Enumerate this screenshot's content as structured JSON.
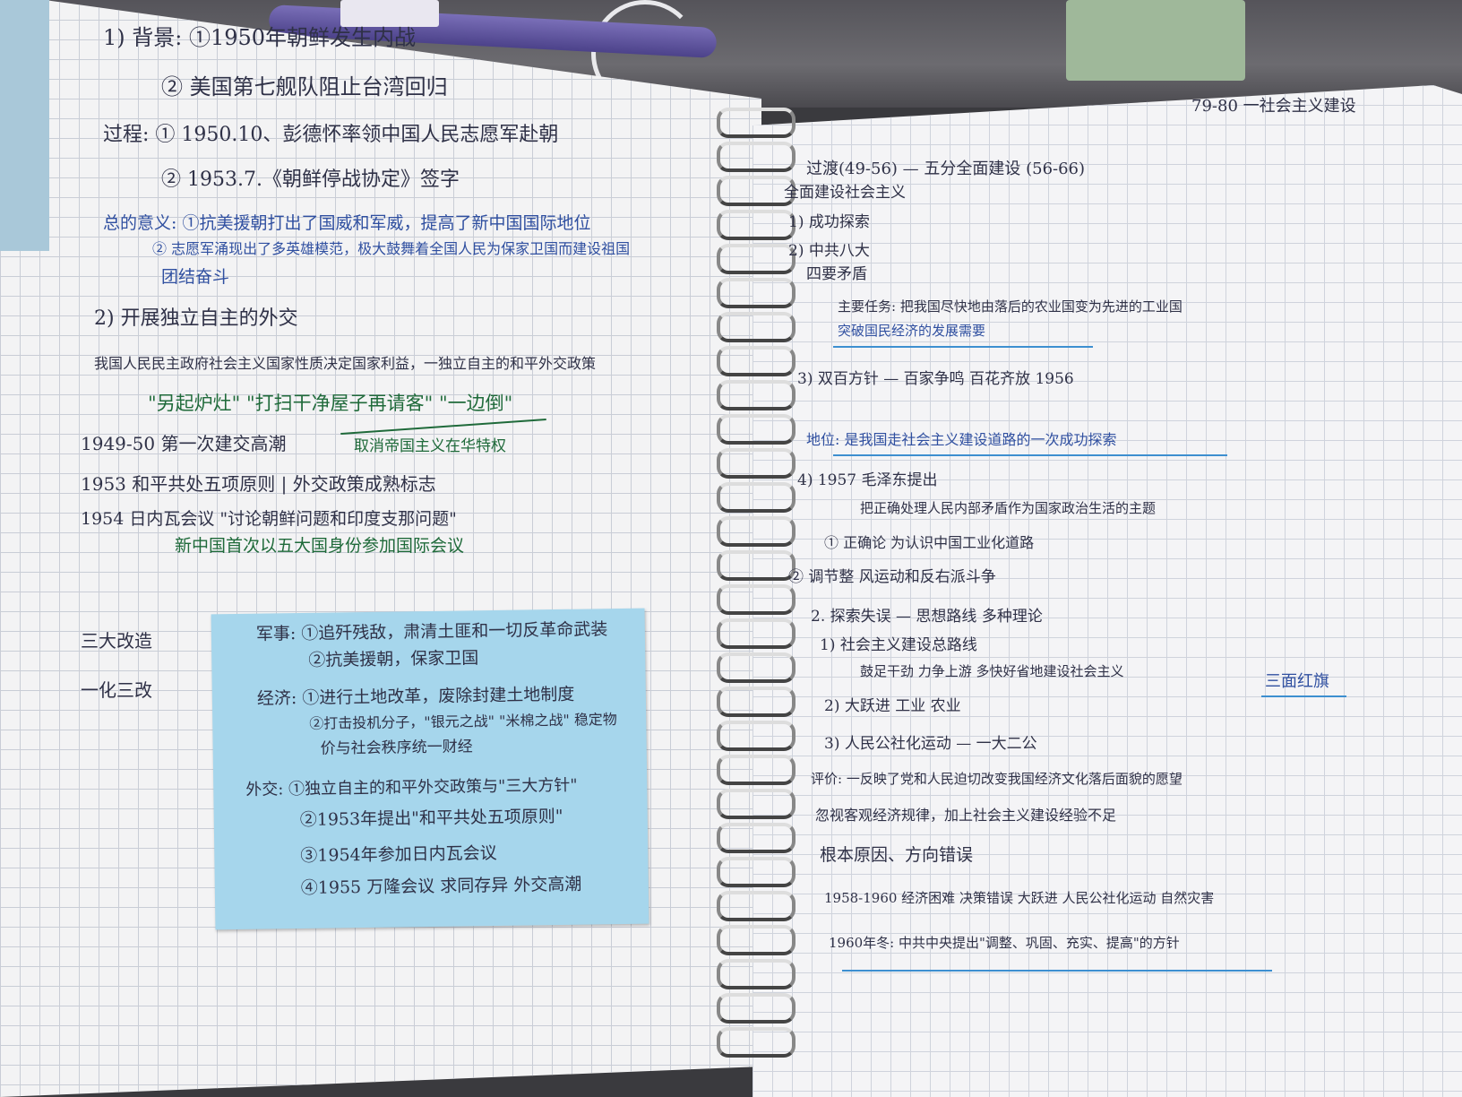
{
  "scene": {
    "description_colors": {
      "paper": "#f3f3f4",
      "grid": "#c9cdd6",
      "sticky_note": "#a6d6ec",
      "ink_dark": "#2f3147",
      "ink_blue": "#2f4fa0",
      "ink_green": "#1f6a3a"
    }
  },
  "left_page": {
    "lines": [
      "1) 背景: ①1950年朝鲜发生内战",
      "② 美国第七舰队阻止台湾回归",
      "过程: ① 1950.10、彭德怀率领中国人民志愿军赴朝",
      "② 1953.7.《朝鲜停战协定》签字",
      "总的意义: ①抗美援朝打出了国威和军威，提高了新中国国际地位",
      "② 志愿军涌现出了多英雄模范，极大鼓舞着全国人民为保家卫国而建设祖国",
      "团结奋斗",
      "2) 开展独立自主的外交",
      "我国人民民主政府社会主义国家性质决定国家利益，一独立自主的和平外交政策",
      "\"另起炉灶\"  \"打扫干净屋子再请客\"  \"一边倒\"",
      "取消帝国主义在华特权",
      "1949-50  第一次建交高潮",
      "1953  和平共处五项原则 | 外交政策成熟标志",
      "1954  日内瓦会议 \"讨论朝鲜问题和印度支那问题\"",
      "新中国首次以五大国身份参加国际会议",
      "三大改造",
      "一化三改"
    ],
    "sticky_note": [
      "军事: ①追歼残敌，肃清土匪和一切反革命武装",
      "②抗美援朝，保家卫国",
      "经济: ①进行土地改革，废除封建土地制度",
      "②打击投机分子，\"银元之战\" \"米棉之战\" 稳定物",
      "价与社会秩序统一财经",
      "外交: ①独立自主的和平外交政策与\"三大方针\"",
      "②1953年提出\"和平共处五项原则\"",
      "③1954年参加日内瓦会议",
      "④1955 万隆会议 求同存异 外交高潮"
    ]
  },
  "right_page": {
    "lines": [
      "79-80 一社会主义建设",
      "过渡(49-56) — 五分全面建设 (56-66)",
      "全面建设社会主义",
      "1) 成功探索",
      "2) 中共八大",
      "四要矛盾",
      "主要任务: 把我国尽快地由落后的农业国变为先进的工业国",
      "突破国民经济的发展需要",
      "3) 双百方针 — 百家争鸣 百花齐放 1956",
      "地位: 是我国走社会主义建设道路的一次成功探索",
      "4) 1957 毛泽东提出",
      "把正确处理人民内部矛盾作为国家政治生活的主题",
      "① 正确论 为认识中国工业化道路",
      "② 调节整 风运动和反右派斗争",
      "2. 探索失误 — 思想路线 多种理论",
      "1) 社会主义建设总路线",
      "鼓足干劲 力争上游 多快好省地建设社会主义",
      "2) 大跃进  工业 农业",
      "3) 人民公社化运动 — 一大二公",
      "三面红旗",
      "评价: 一反映了党和人民迫切改变我国经济文化落后面貌的愿望",
      "忽视客观经济规律，加上社会主义建设经验不足",
      "根本原因、方向错误",
      "1958-1960 经济困难 决策错误 大跃进 人民公社化运动 自然灾害",
      "1960年冬: 中共中央提出\"调整、巩固、充实、提高\"的方针"
    ]
  }
}
